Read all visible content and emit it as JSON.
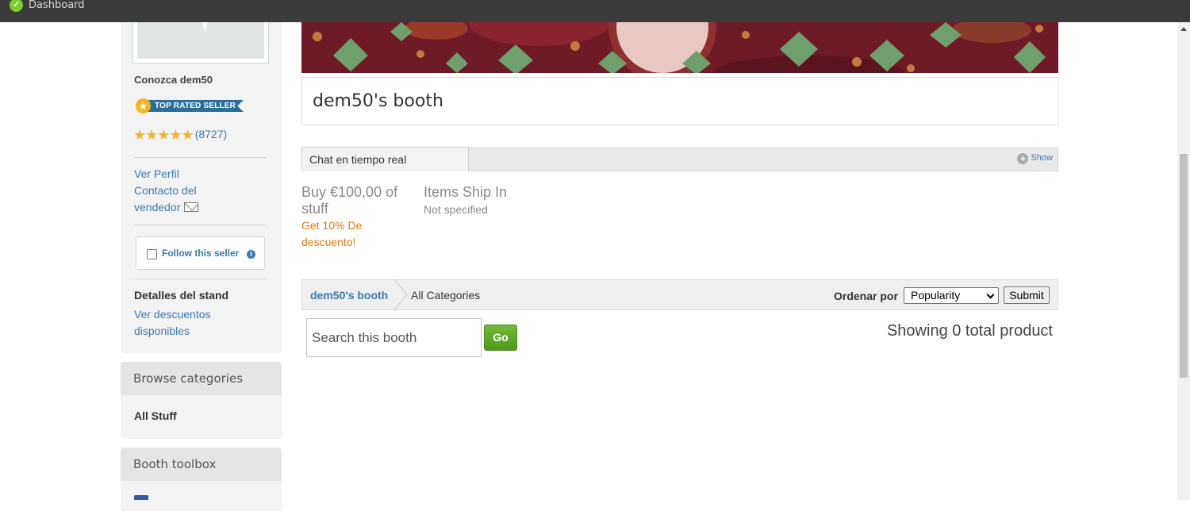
{
  "topbar": {
    "title": "Dashboard",
    "logo_glyph": "✓"
  },
  "seller": {
    "know_label": "Conozca dem50",
    "badge": "TOP RATED SELLER",
    "stars": "★★★★★",
    "rating_count": "(8727)",
    "view_profile": "Ver Perfil",
    "contact_line1": "Contacto del",
    "contact_line2": "vendedor",
    "follow_label": "Follow this seller",
    "info_glyph": "i",
    "booth_details": "Detalles del stand",
    "discounts_line1": "Ver descuentos",
    "discounts_line2": "disponibles"
  },
  "browse": {
    "heading": "Browse categories",
    "item": "All Stuff"
  },
  "toolbox": {
    "heading": "Booth toolbox"
  },
  "booth": {
    "title": "dem50's booth",
    "chat_tab": "Chat en tiempo real",
    "show_label": "Show",
    "show_glyph": "+",
    "promo_title": "Buy €100,00 of stuff",
    "promo_sub": "Get 10% De descuento!",
    "ship_title": "Items Ship In",
    "ship_value": "Not specified"
  },
  "breadcrumb": {
    "home": "dem50's booth",
    "current": "All Categories"
  },
  "sort": {
    "label": "Ordenar por",
    "selected": "Popularity",
    "submit": "Submit"
  },
  "search": {
    "placeholder": "Search this booth",
    "go": "Go"
  },
  "results": {
    "summary": "Showing 0 total product"
  },
  "colors": {
    "link": "#3a7ab1",
    "accent_orange": "#e07a10",
    "go_green": "#5aa621",
    "banner": "#6e1a27"
  }
}
